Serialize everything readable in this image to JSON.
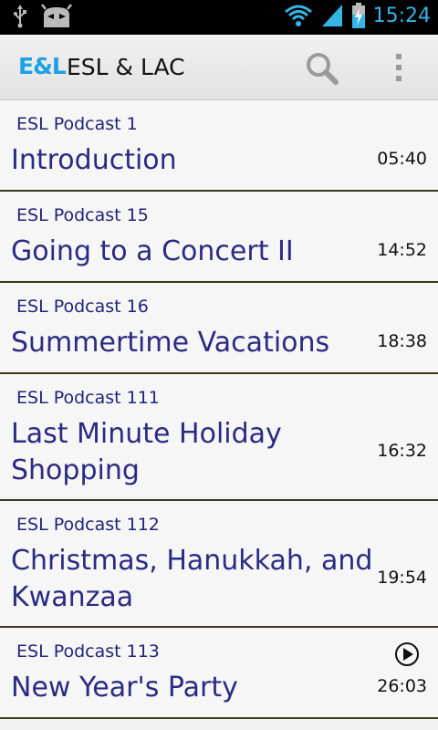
{
  "status_bar": {
    "time": "15:24",
    "icons": [
      "usb-icon",
      "android-debug-icon",
      "wifi-icon",
      "signal-icon",
      "battery-charging-icon"
    ]
  },
  "action_bar": {
    "logo": "E&L",
    "title": "ESL & LAC",
    "icons": [
      "search-icon",
      "overflow-menu-icon"
    ]
  },
  "episodes": [
    {
      "subtitle": "ESL Podcast 1",
      "title_lines": [
        "Introduction"
      ],
      "duration": "05:40",
      "playing": false
    },
    {
      "subtitle": "ESL Podcast 15",
      "title_lines": [
        "Going to a Concert II"
      ],
      "duration": "14:52",
      "playing": false
    },
    {
      "subtitle": "ESL Podcast 16",
      "title_lines": [
        "Summertime Vacations"
      ],
      "duration": "18:38",
      "playing": false
    },
    {
      "subtitle": "ESL Podcast 111",
      "title_lines": [
        "Last Minute Holiday",
        "Shopping"
      ],
      "duration": "16:32",
      "playing": false
    },
    {
      "subtitle": "ESL Podcast 112",
      "title_lines": [
        "Christmas, Hanukkah, and",
        "Kwanzaa"
      ],
      "duration": "19:54",
      "playing": false
    },
    {
      "subtitle": "ESL Podcast 113",
      "title_lines": [
        "New Year's Party"
      ],
      "duration": "26:03",
      "playing": true
    }
  ],
  "colors": {
    "accent": "#33b5e5",
    "logo": "#1da1e8",
    "title_text": "#2b2b83",
    "subtitle_text": "#23237a",
    "divider": "#3a3a20"
  }
}
